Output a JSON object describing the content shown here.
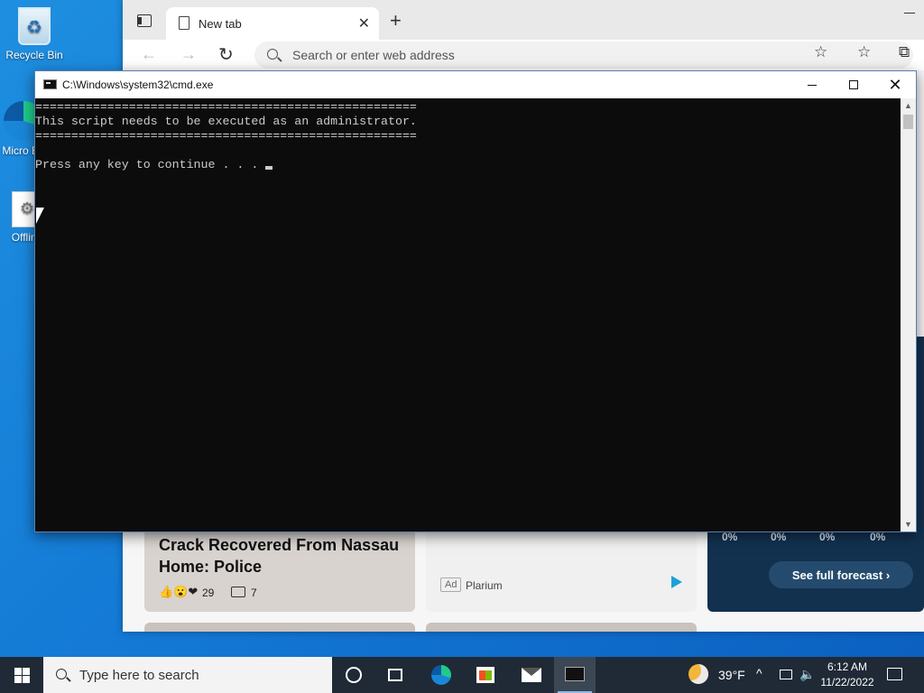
{
  "desktop": {
    "icons": [
      {
        "label": "Recycle Bin"
      },
      {
        "label": "Micro Ed"
      },
      {
        "label": "Offline"
      }
    ]
  },
  "browser": {
    "tab_title": "New tab",
    "address_placeholder": "Search or enter web address",
    "news": {
      "story_title": "Crack Recovered From Nassau Home: Police",
      "reaction_count": "29",
      "comment_count": "7",
      "ad_badge": "Ad",
      "ad_source": "Plarium",
      "precip": [
        "0%",
        "0%",
        "0%",
        "0%"
      ],
      "forecast_button": "See full forecast ›"
    }
  },
  "cmd": {
    "title": "C:\\Windows\\system32\\cmd.exe",
    "lines": [
      "=====================================================",
      "This script needs to be executed as an administrator.",
      "=====================================================",
      "",
      "Press any key to continue . . . "
    ]
  },
  "taskbar": {
    "search_placeholder": "Type here to search",
    "temperature": "39°F",
    "time": "6:12 AM",
    "date": "11/22/2022"
  },
  "colors": {
    "console_bg": "#0c0c0c",
    "console_fg": "#cccccc",
    "taskbar_bg": "#1f2a36"
  }
}
